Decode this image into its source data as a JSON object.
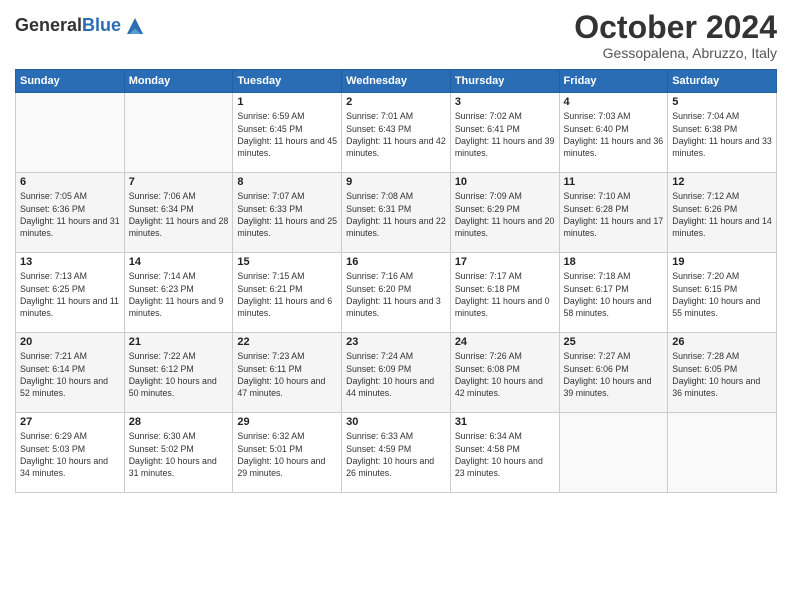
{
  "header": {
    "logo_general": "General",
    "logo_blue": "Blue",
    "month_title": "October 2024",
    "location": "Gessopalena, Abruzzo, Italy"
  },
  "days_of_week": [
    "Sunday",
    "Monday",
    "Tuesday",
    "Wednesday",
    "Thursday",
    "Friday",
    "Saturday"
  ],
  "weeks": [
    [
      {
        "day": "",
        "info": ""
      },
      {
        "day": "",
        "info": ""
      },
      {
        "day": "1",
        "info": "Sunrise: 6:59 AM\nSunset: 6:45 PM\nDaylight: 11 hours and 45 minutes."
      },
      {
        "day": "2",
        "info": "Sunrise: 7:01 AM\nSunset: 6:43 PM\nDaylight: 11 hours and 42 minutes."
      },
      {
        "day": "3",
        "info": "Sunrise: 7:02 AM\nSunset: 6:41 PM\nDaylight: 11 hours and 39 minutes."
      },
      {
        "day": "4",
        "info": "Sunrise: 7:03 AM\nSunset: 6:40 PM\nDaylight: 11 hours and 36 minutes."
      },
      {
        "day": "5",
        "info": "Sunrise: 7:04 AM\nSunset: 6:38 PM\nDaylight: 11 hours and 33 minutes."
      }
    ],
    [
      {
        "day": "6",
        "info": "Sunrise: 7:05 AM\nSunset: 6:36 PM\nDaylight: 11 hours and 31 minutes."
      },
      {
        "day": "7",
        "info": "Sunrise: 7:06 AM\nSunset: 6:34 PM\nDaylight: 11 hours and 28 minutes."
      },
      {
        "day": "8",
        "info": "Sunrise: 7:07 AM\nSunset: 6:33 PM\nDaylight: 11 hours and 25 minutes."
      },
      {
        "day": "9",
        "info": "Sunrise: 7:08 AM\nSunset: 6:31 PM\nDaylight: 11 hours and 22 minutes."
      },
      {
        "day": "10",
        "info": "Sunrise: 7:09 AM\nSunset: 6:29 PM\nDaylight: 11 hours and 20 minutes."
      },
      {
        "day": "11",
        "info": "Sunrise: 7:10 AM\nSunset: 6:28 PM\nDaylight: 11 hours and 17 minutes."
      },
      {
        "day": "12",
        "info": "Sunrise: 7:12 AM\nSunset: 6:26 PM\nDaylight: 11 hours and 14 minutes."
      }
    ],
    [
      {
        "day": "13",
        "info": "Sunrise: 7:13 AM\nSunset: 6:25 PM\nDaylight: 11 hours and 11 minutes."
      },
      {
        "day": "14",
        "info": "Sunrise: 7:14 AM\nSunset: 6:23 PM\nDaylight: 11 hours and 9 minutes."
      },
      {
        "day": "15",
        "info": "Sunrise: 7:15 AM\nSunset: 6:21 PM\nDaylight: 11 hours and 6 minutes."
      },
      {
        "day": "16",
        "info": "Sunrise: 7:16 AM\nSunset: 6:20 PM\nDaylight: 11 hours and 3 minutes."
      },
      {
        "day": "17",
        "info": "Sunrise: 7:17 AM\nSunset: 6:18 PM\nDaylight: 11 hours and 0 minutes."
      },
      {
        "day": "18",
        "info": "Sunrise: 7:18 AM\nSunset: 6:17 PM\nDaylight: 10 hours and 58 minutes."
      },
      {
        "day": "19",
        "info": "Sunrise: 7:20 AM\nSunset: 6:15 PM\nDaylight: 10 hours and 55 minutes."
      }
    ],
    [
      {
        "day": "20",
        "info": "Sunrise: 7:21 AM\nSunset: 6:14 PM\nDaylight: 10 hours and 52 minutes."
      },
      {
        "day": "21",
        "info": "Sunrise: 7:22 AM\nSunset: 6:12 PM\nDaylight: 10 hours and 50 minutes."
      },
      {
        "day": "22",
        "info": "Sunrise: 7:23 AM\nSunset: 6:11 PM\nDaylight: 10 hours and 47 minutes."
      },
      {
        "day": "23",
        "info": "Sunrise: 7:24 AM\nSunset: 6:09 PM\nDaylight: 10 hours and 44 minutes."
      },
      {
        "day": "24",
        "info": "Sunrise: 7:26 AM\nSunset: 6:08 PM\nDaylight: 10 hours and 42 minutes."
      },
      {
        "day": "25",
        "info": "Sunrise: 7:27 AM\nSunset: 6:06 PM\nDaylight: 10 hours and 39 minutes."
      },
      {
        "day": "26",
        "info": "Sunrise: 7:28 AM\nSunset: 6:05 PM\nDaylight: 10 hours and 36 minutes."
      }
    ],
    [
      {
        "day": "27",
        "info": "Sunrise: 6:29 AM\nSunset: 5:03 PM\nDaylight: 10 hours and 34 minutes."
      },
      {
        "day": "28",
        "info": "Sunrise: 6:30 AM\nSunset: 5:02 PM\nDaylight: 10 hours and 31 minutes."
      },
      {
        "day": "29",
        "info": "Sunrise: 6:32 AM\nSunset: 5:01 PM\nDaylight: 10 hours and 29 minutes."
      },
      {
        "day": "30",
        "info": "Sunrise: 6:33 AM\nSunset: 4:59 PM\nDaylight: 10 hours and 26 minutes."
      },
      {
        "day": "31",
        "info": "Sunrise: 6:34 AM\nSunset: 4:58 PM\nDaylight: 10 hours and 23 minutes."
      },
      {
        "day": "",
        "info": ""
      },
      {
        "day": "",
        "info": ""
      }
    ]
  ]
}
